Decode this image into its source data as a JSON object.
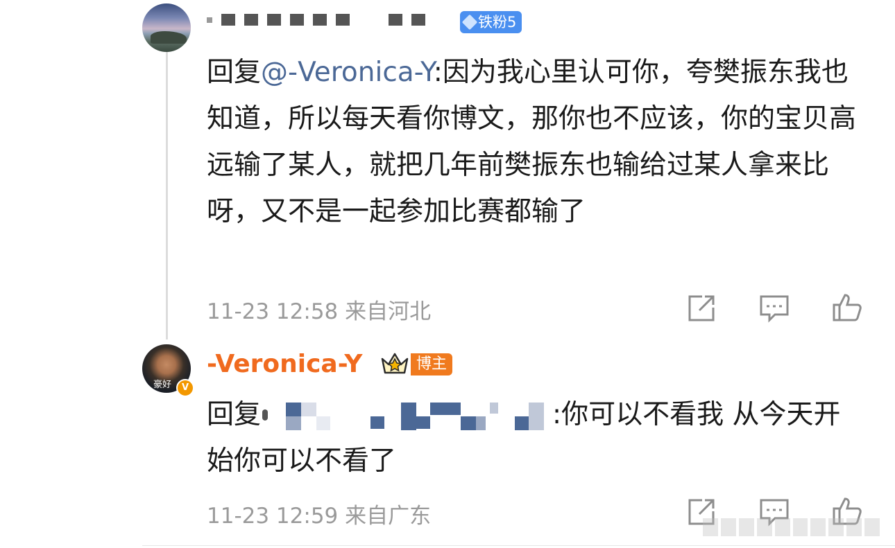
{
  "comment1": {
    "avatar_icon": "landscape-avatar",
    "fan_badge_label": "铁粉5",
    "reply_prefix": "回复",
    "reply_to": "@-Veronica-Y",
    "text": ":因为我心里认可你，夸樊振东我也知道，所以每天看你博文，那你也不应该，你的宝贝高远输了某人，就把几年前樊振东也输给过某人拿来比呀，又不是一起参加比赛都输了",
    "time": "11-23 12:58",
    "location": "来自河北"
  },
  "comment2": {
    "username": "-Veronica-Y",
    "avatar_text": "豪好",
    "verified_badge": "V",
    "blogger_badge": "博主",
    "reply_prefix": "回复",
    "text": ":你可以不看我 从今天开始你可以不看了",
    "time": "11-23 12:59",
    "location": "来自广东"
  },
  "icons": {
    "share": "share-icon",
    "comment": "comment-icon",
    "like": "like-icon"
  },
  "colors": {
    "link": "#4b6896",
    "username_orange": "#f06a1e",
    "fan_badge_blue": "#4a8ff0",
    "meta_gray": "#9a9a9a"
  }
}
